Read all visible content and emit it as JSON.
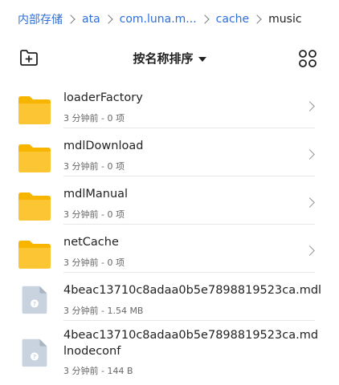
{
  "breadcrumb": [
    {
      "label": "内部存储"
    },
    {
      "label": "ata"
    },
    {
      "label": "com.luna.m..."
    },
    {
      "label": "cache"
    },
    {
      "label": "music"
    }
  ],
  "toolbar": {
    "new_folder_icon": "new-folder-icon",
    "sort_label": "按名称排序",
    "view_icon": "grid-view-icon"
  },
  "items": [
    {
      "type": "folder",
      "name": "loaderFactory",
      "meta": "3 分钟前 - 0 项"
    },
    {
      "type": "folder",
      "name": "mdlDownload",
      "meta": "3 分钟前 - 0 项"
    },
    {
      "type": "folder",
      "name": "mdlManual",
      "meta": "3 分钟前 - 0 项"
    },
    {
      "type": "folder",
      "name": "netCache",
      "meta": "3 分钟前 - 0 项"
    },
    {
      "type": "file",
      "name": "4beac13710c8adaa0b5e7898819523ca.mdl",
      "meta": "3 分钟前 - 1.54 MB"
    },
    {
      "type": "file",
      "name": "4beac13710c8adaa0b5e7898819523ca.mdlnodeconf",
      "meta": "3 分钟前 - 144 B"
    }
  ],
  "colors": {
    "accent": "#2f6fd6",
    "folder": "#f7b500",
    "file": "#c9d3df"
  }
}
